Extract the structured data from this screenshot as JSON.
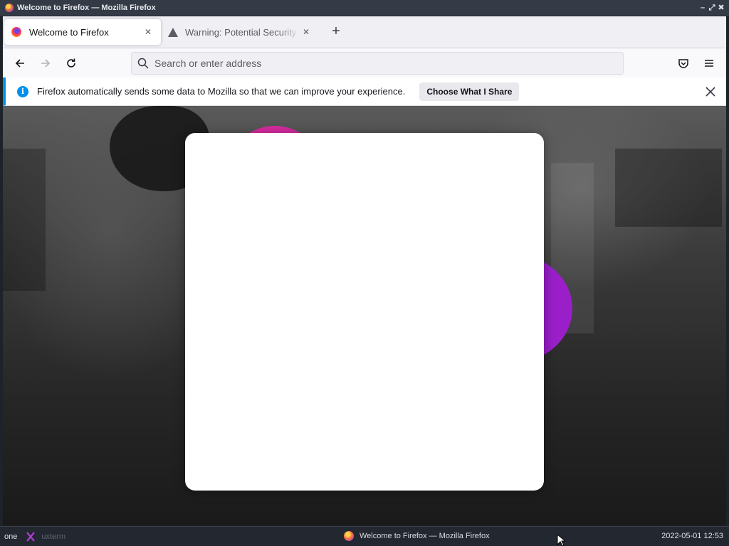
{
  "window": {
    "title": "Welcome to Firefox — Mozilla Firefox",
    "controls": [
      "minimize",
      "maximize",
      "close"
    ]
  },
  "tabs": [
    {
      "label": "Welcome to Firefox",
      "icon": "firefox-icon",
      "active": true,
      "close": "✕"
    },
    {
      "label": "Warning: Potential Security Risk Ahead",
      "icon": "warning-icon",
      "active": false,
      "close": "✕"
    }
  ],
  "newtab_label": "+",
  "navbar": {
    "back_icon": "back-arrow-icon",
    "forward_icon": "forward-arrow-icon",
    "reload_icon": "reload-icon",
    "url_placeholder": "Search or enter address",
    "url_value": "",
    "pocket_icon": "pocket-icon",
    "menu_icon": "hamburger-menu-icon"
  },
  "notification": {
    "info_glyph": "i",
    "message": "Firefox automatically sends some data to Mozilla so that we can improve your experience.",
    "button_label": "Choose What I Share",
    "close_icon": "close-icon"
  },
  "taskbar": {
    "workspace": "one",
    "xterm_label": "uxterm",
    "task_label": "Welcome to Firefox — Mozilla Firefox",
    "clock": "2022-05-01 12:53"
  },
  "colors": {
    "accent_blue": "#0090ed",
    "blob_pink": "#d62ba0",
    "blob_purple": "#9a1fc9"
  }
}
